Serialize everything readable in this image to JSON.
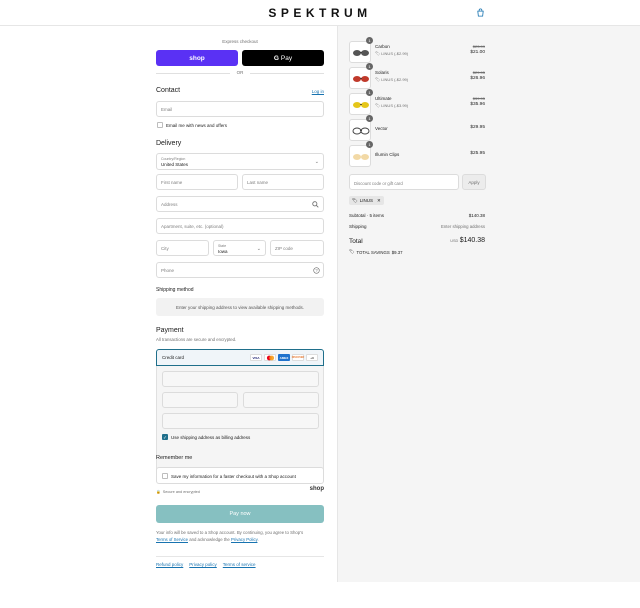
{
  "header": {
    "brand": "SPEKTRUM",
    "cart_icon": "shopping-bag-icon"
  },
  "express": {
    "title": "Express checkout",
    "shop_label": "shop",
    "gpay_label": "Pay",
    "gpay_g": "G",
    "or_label": "OR"
  },
  "contact": {
    "title": "Contact",
    "login_label": "Log in",
    "email_placeholder": "Email",
    "newsletter_label": "Email me with news and offers"
  },
  "delivery": {
    "title": "Delivery",
    "country_label": "Country/Region",
    "country_value": "United States",
    "first_name_placeholder": "First name",
    "last_name_placeholder": "Last name",
    "address_placeholder": "Address",
    "apartment_placeholder": "Apartment, suite, etc. (optional)",
    "city_placeholder": "City",
    "state_label": "State",
    "state_value": "Iowa",
    "zip_placeholder": "ZIP code",
    "phone_placeholder": "Phone"
  },
  "shipping": {
    "title": "Shipping method",
    "message": "Enter your shipping address to view available shipping methods."
  },
  "payment": {
    "title": "Payment",
    "subtitle": "All transactions are secure and encrypted.",
    "method_label": "Credit card",
    "cards": [
      "VISA",
      "MC",
      "AMEX",
      "DISCOVER"
    ],
    "more_cards": "+3",
    "billing_label": "Use shipping address as billing address"
  },
  "remember": {
    "title": "Remember me",
    "save_label": "Save my information for a faster checkout with a Shop account",
    "secure_label": "Secure and encrypted",
    "shop_logo": "shop"
  },
  "pay_button": "Pay now",
  "legal": {
    "line1": "Your info will be saved to a Shop account. By continuing, you agree to Shop's",
    "terms": "Terms of Service",
    "mid": " and acknowledge the ",
    "privacy": "Privacy Policy",
    "end": "."
  },
  "footer": {
    "refund": "Refund policy",
    "privacy": "Privacy policy",
    "terms": "Terms of service"
  },
  "summary": {
    "items": [
      {
        "name": "Carbon",
        "qty": "1",
        "discount": "LINUS (-$2.99)",
        "old_price": "$23.99",
        "price": "$21.00"
      },
      {
        "name": "Solaris",
        "qty": "1",
        "discount": "LINUS (-$2.99)",
        "old_price": "$29.95",
        "price": "$26.96"
      },
      {
        "name": "Ultimate",
        "qty": "1",
        "discount": "LINUS (-$3.99)",
        "old_price": "$39.95",
        "price": "$35.96"
      },
      {
        "name": "Vector",
        "qty": "1",
        "discount": "",
        "old_price": "",
        "price": "$29.95"
      },
      {
        "name": "Illumin Clips",
        "qty": "1",
        "discount": "",
        "old_price": "",
        "price": "$25.95"
      }
    ],
    "discount_placeholder": "Discount code or gift card",
    "apply_label": "Apply",
    "applied_code": "LINUS",
    "subtotal_label": "Subtotal · 5 items",
    "subtotal_value": "$140.38",
    "shipping_label": "Shipping",
    "shipping_value": "Enter shipping address",
    "total_label": "Total",
    "currency": "USD",
    "total_value": "$140.38",
    "savings_label": "TOTAL SAVINGS",
    "savings_value": "$9.37"
  }
}
